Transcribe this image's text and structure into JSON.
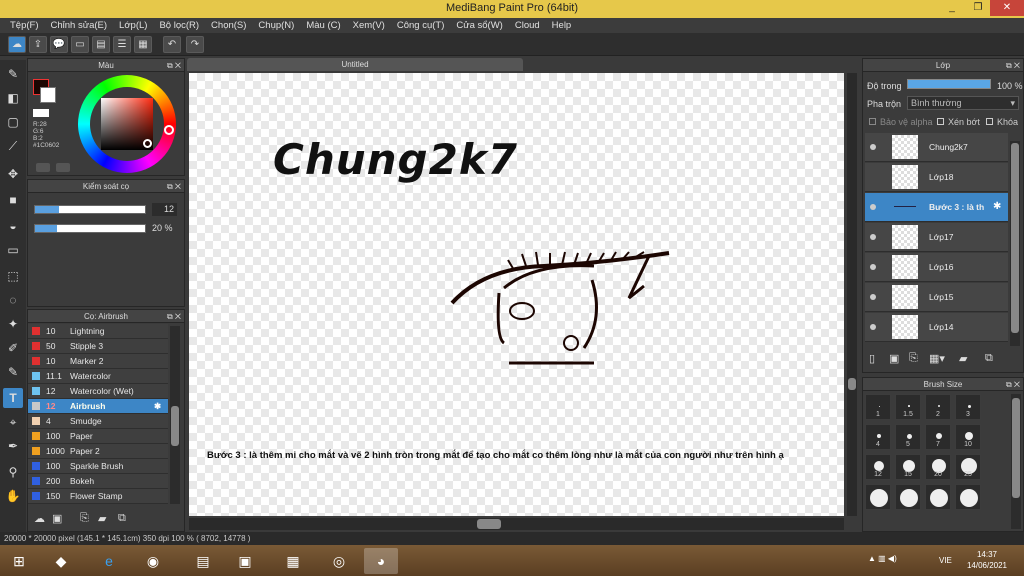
{
  "app": {
    "title": "MediBang Paint Pro (64bit)",
    "window_controls": [
      "_",
      "❐",
      "✕"
    ]
  },
  "menu": [
    "Tệp(F)",
    "Chỉnh sửa(E)",
    "Lớp(L)",
    "Bộ lọc(R)",
    "Chọn(S)",
    "Chụp(N)",
    "Màu (C)",
    "Xem(V)",
    "Công cụ(T)",
    "Cửa sổ(W)",
    "Cloud",
    "Help"
  ],
  "color_panel": {
    "title": "Màu",
    "readout": [
      "R:28",
      "G:6",
      "B:2",
      "#1C0602"
    ],
    "main_color": "#1C0602"
  },
  "brush_control": {
    "title": "Kiểm soát cọ",
    "size": "12",
    "opacity": "20 %"
  },
  "brush_panel": {
    "title": "Cọ: Airbrush",
    "items": [
      {
        "size": "10",
        "name": "Lightning",
        "color": "#e03030"
      },
      {
        "size": "50",
        "name": "Stipple 3",
        "color": "#e03030"
      },
      {
        "size": "10",
        "name": "Marker 2",
        "color": "#e03030"
      },
      {
        "size": "11.1",
        "name": "Watercolor",
        "color": "#6ec3f0"
      },
      {
        "size": "12",
        "name": "Watercolor (Wet)",
        "color": "#6ec3f0"
      },
      {
        "size": "12",
        "name": "Airbrush",
        "color": "#c8c8c8"
      },
      {
        "size": "4",
        "name": "Smudge",
        "color": "#f0d0b0"
      },
      {
        "size": "100",
        "name": "Paper",
        "color": "#f0a020"
      },
      {
        "size": "1000",
        "name": "Paper 2",
        "color": "#f0a020"
      },
      {
        "size": "100",
        "name": "Sparkle Brush",
        "color": "#3060e0"
      },
      {
        "size": "200",
        "name": "Bokeh",
        "color": "#3060e0"
      },
      {
        "size": "150",
        "name": "Flower Stamp",
        "color": "#3060e0"
      }
    ]
  },
  "canvas": {
    "tab_title": "Untitled",
    "heading": "Chung2k7",
    "caption": "Bước 3 : là thêm mi cho mắt và vẽ 2 hình tròn trong mắt để tạo cho mắt co thêm lòng như là mắt của con người như trên hình ạ"
  },
  "layer_panel": {
    "title": "Lớp",
    "opacity_label": "Độ trong",
    "opacity_value": "100 %",
    "blend_label": "Pha trộn",
    "blend_value": "Bình thường",
    "protect_alpha": "Bảo vệ alpha",
    "clipping": "Xén bớt",
    "lock": "Khóa",
    "layers": [
      {
        "name": "Chung2k7"
      },
      {
        "name": "Lớp18"
      },
      {
        "name": "Bước 3 : là th"
      },
      {
        "name": "Lớp17"
      },
      {
        "name": "Lớp16"
      },
      {
        "name": "Lớp15"
      },
      {
        "name": "Lớp14"
      }
    ]
  },
  "brush_size_panel": {
    "title": "Brush Size",
    "sizes": [
      "1",
      "1.5",
      "2",
      "3",
      "4",
      "5",
      "7",
      "10",
      "12",
      "15",
      "20",
      "25",
      "",
      "",
      "",
      ""
    ]
  },
  "status": "20000 * 20000 pixel  (145.1 * 145.1cm)  350 dpi  100 %  ( 8702, 14778 )",
  "taskbar": {
    "lang": "VIE",
    "time": "14:37",
    "date": "14/06/2021"
  }
}
